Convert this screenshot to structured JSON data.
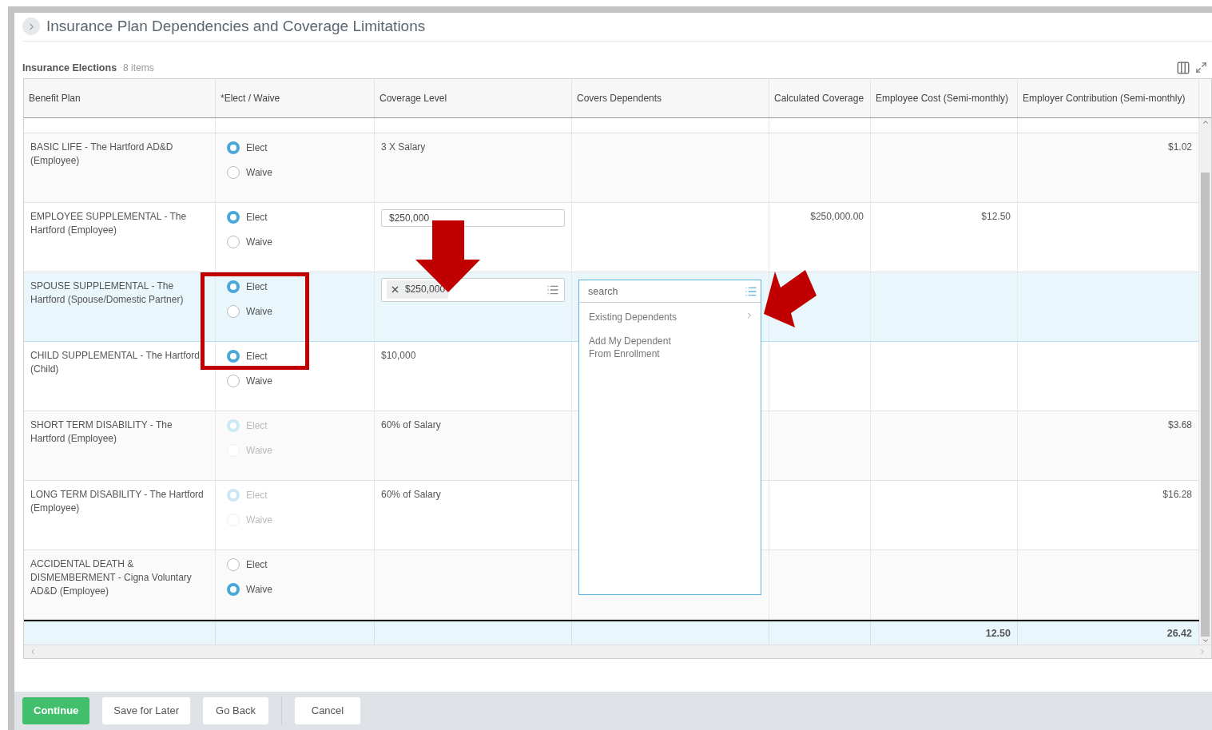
{
  "page": {
    "title": "Insurance Plan Dependencies and Coverage Limitations"
  },
  "grid": {
    "title": "Insurance Elections",
    "count": "8 items",
    "columns": [
      "Benefit Plan",
      "*Elect / Waive",
      "Coverage Level",
      "Covers Dependents",
      "Calculated Coverage",
      "Employee Cost (Semi-monthly)",
      "Employer Contribution (Semi-monthly)"
    ],
    "rows": [
      {
        "plan": "BASIC LIFE - The Hartford AD&D (Employee)",
        "selected": false,
        "disabled": false,
        "options": [
          {
            "label": "Elect",
            "selected": true
          },
          {
            "label": "Waive",
            "selected": false
          }
        ],
        "coverage": {
          "kind": "text",
          "value": "3 X Salary"
        },
        "employer_contribution": "$1.02"
      },
      {
        "plan": "EMPLOYEE SUPPLEMENTAL - The Hartford (Employee)",
        "selected": false,
        "disabled": false,
        "options": [
          {
            "label": "Elect",
            "selected": true
          },
          {
            "label": "Waive",
            "selected": false
          }
        ],
        "coverage": {
          "kind": "input",
          "value": "$250,000"
        },
        "calculated_coverage": "$250,000.00",
        "employee_cost": "$12.50"
      },
      {
        "plan": "SPOUSE SUPPLEMENTAL - The Hartford (Spouse/Domestic Partner)",
        "selected": true,
        "disabled": false,
        "options": [
          {
            "label": "Elect",
            "selected": true
          },
          {
            "label": "Waive",
            "selected": false
          }
        ],
        "coverage": {
          "kind": "tag",
          "value": "$250,000"
        }
      },
      {
        "plan": "CHILD SUPPLEMENTAL - The Hartford (Child)",
        "selected": false,
        "disabled": false,
        "options": [
          {
            "label": "Elect",
            "selected": true
          },
          {
            "label": "Waive",
            "selected": false
          }
        ],
        "coverage": {
          "kind": "text",
          "value": "$10,000"
        }
      },
      {
        "plan": "SHORT TERM DISABILITY - The Hartford (Employee)",
        "selected": false,
        "disabled": true,
        "options": [
          {
            "label": "Elect",
            "selected": true
          },
          {
            "label": "Waive",
            "selected": false
          }
        ],
        "coverage": {
          "kind": "text",
          "value": "60% of Salary"
        },
        "employer_contribution": "$3.68"
      },
      {
        "plan": "LONG TERM DISABILITY - The Hartford (Employee)",
        "selected": false,
        "disabled": true,
        "options": [
          {
            "label": "Elect",
            "selected": true
          },
          {
            "label": "Waive",
            "selected": false
          }
        ],
        "coverage": {
          "kind": "text",
          "value": "60% of Salary"
        },
        "employer_contribution": "$16.28"
      },
      {
        "plan": "ACCIDENTAL DEATH & DISMEMBERMENT - Cigna Voluntary AD&D (Employee)",
        "selected": false,
        "disabled": false,
        "options": [
          {
            "label": "Elect",
            "selected": false
          },
          {
            "label": "Waive",
            "selected": true
          }
        ]
      }
    ],
    "totals": {
      "employee_cost": "12.50",
      "employer_contribution": "26.42"
    }
  },
  "dependents_prompt": {
    "placeholder": "search",
    "items": [
      {
        "label": "Existing Dependents",
        "submenu": true
      },
      {
        "label": "Add My Dependent From Enrollment",
        "submenu": false
      }
    ]
  },
  "buttons": [
    {
      "label": "Continue",
      "kind": "primary",
      "separated": false
    },
    {
      "label": "Save for Later",
      "kind": "secondary",
      "separated": false
    },
    {
      "label": "Go Back",
      "kind": "secondary",
      "separated": false
    },
    {
      "label": "Cancel",
      "kind": "secondary",
      "separated": true
    }
  ]
}
